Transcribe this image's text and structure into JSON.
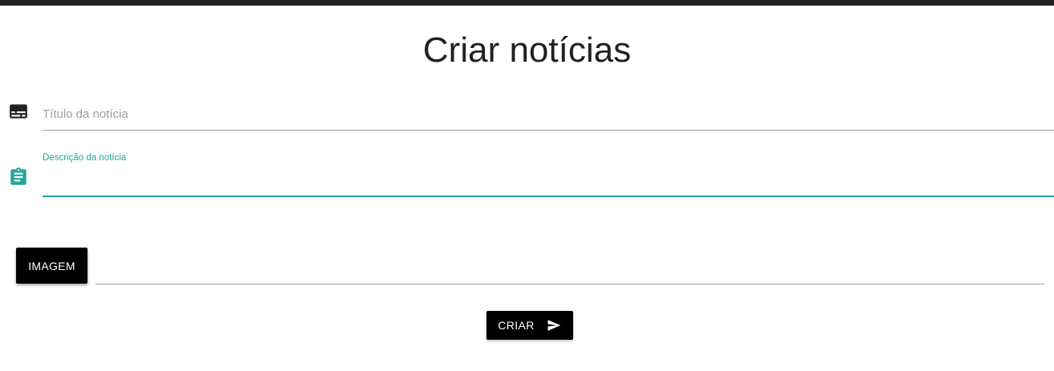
{
  "page": {
    "title": "Criar notícias"
  },
  "form": {
    "title_field": {
      "icon": "subtitles-icon",
      "placeholder": "Título da notícia",
      "value": ""
    },
    "description_field": {
      "icon": "assignment-icon",
      "label": "Descrição da notícia",
      "value": ""
    },
    "image_field": {
      "button_label": "IMAGEM",
      "file_path_value": ""
    },
    "submit": {
      "label": "CRIAR",
      "icon": "send-icon"
    }
  },
  "colors": {
    "accent": "#26a69a",
    "button_bg": "#000000",
    "top_bar": "#222222"
  }
}
